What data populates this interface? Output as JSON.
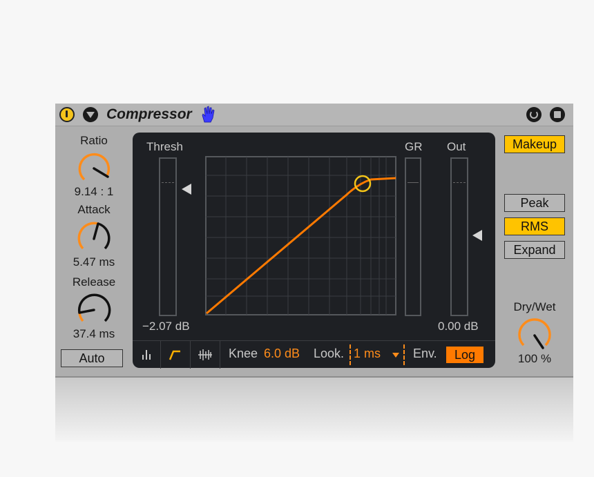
{
  "device": {
    "title": "Compressor",
    "power_on": true
  },
  "left_panel": {
    "ratio": {
      "label": "Ratio",
      "value": "9.14 : 1"
    },
    "attack": {
      "label": "Attack",
      "value": "5.47 ms"
    },
    "release": {
      "label": "Release",
      "value": "37.4 ms"
    },
    "auto_label": "Auto"
  },
  "display": {
    "thresh_label": "Thresh",
    "gr_label": "GR",
    "out_label": "Out",
    "thresh_value": "−2.07 dB",
    "out_value": "0.00 dB",
    "knee_label": "Knee",
    "knee_value": "6.0 dB",
    "look_label": "Look.",
    "look_value": "1 ms",
    "env_label": "Env.",
    "env_value": "Log"
  },
  "right_panel": {
    "makeup_label": "Makeup",
    "makeup_on": true,
    "peak_label": "Peak",
    "rms_label": "RMS",
    "expand_label": "Expand",
    "mode_selected": "RMS",
    "drywet_label": "Dry/Wet",
    "drywet_value": "100 %"
  },
  "colors": {
    "accent": "#ff8c1a",
    "active_button": "#ffc300",
    "display_bg": "#1e2024",
    "hand_icon": "#3b3bff"
  },
  "icons": [
    "power-icon",
    "fold-icon",
    "hand-icon",
    "hotswap-icon",
    "save-icon",
    "activity-view-icon",
    "transfer-curve-icon",
    "waveform-view-icon"
  ]
}
